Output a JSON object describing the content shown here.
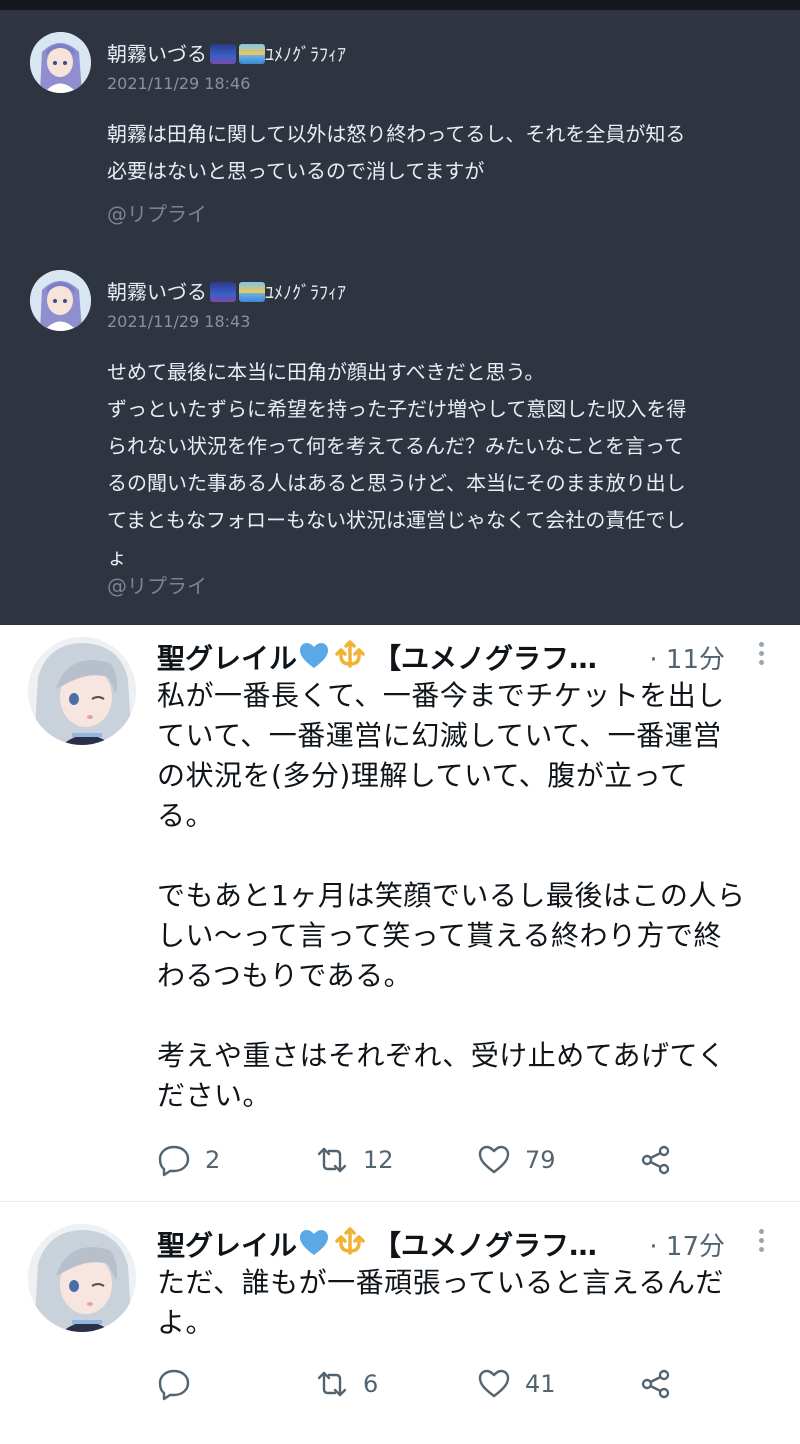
{
  "quoted": [
    {
      "author": "朝霧いづる",
      "name_suffix": "ﾕﾒﾉｸﾞﾗﾌｨｱ",
      "date": "2021/11/29 18:46",
      "text": "朝霧は田角に関して以外は怒り終わってるし、それを全員が知る\n必要はないと思っているので消してますが",
      "reply_label": "@リプライ"
    },
    {
      "author": "朝霧いづる",
      "name_suffix": "ﾕﾒﾉｸﾞﾗﾌｨｱ",
      "date": "2021/11/29 18:43",
      "text": "せめて最後に本当に田角が顔出すべきだと思う。\nずっといたずらに希望を持った子だけ増やして意図した収入を得\nられない状況を作って何を考えてるんだ？みたいなことを言って\nるの聞いた事ある人はあると思うけど、本当にそのまま放り出し\nてまともなフォローもない状況は運営じゃなくて会社の責任でし\nょ",
      "reply_label": "@リプライ"
    }
  ],
  "tweets": [
    {
      "author": "聖グレイル",
      "author_tag": "【ユメノグラフ…",
      "time": "· 11分",
      "text": "私が一番長くて、一番今までチケットを出し\nていて、一番運営に幻滅していて、一番運営\nの状況を(多分)理解していて、腹が立って\nる。\n\nでもあと1ヶ月は笑顔でいるし最後はこの人ら\nしい〜って言って笑って貰える終わり方で終\nわるつもりである。\n\n考えや重さはそれぞれ、受け止めてあげてく\nださい。",
      "replies": "2",
      "retweets": "12",
      "likes": "79"
    },
    {
      "author": "聖グレイル",
      "author_tag": "【ユメノグラフ…",
      "time": "· 17分",
      "text": "ただ、誰もが一番頑張っていると言えるんだ\nよ。",
      "replies": "",
      "retweets": "6",
      "likes": "41"
    }
  ],
  "icons": {
    "reply": "reply-icon",
    "retweet": "retweet-icon",
    "like": "like-icon",
    "share": "share-icon",
    "more": "more-icon"
  },
  "colors": {
    "dark_bg": "#2f3540",
    "heart_blue": "#5aa9e6",
    "crown_gold": "#f2b234"
  }
}
